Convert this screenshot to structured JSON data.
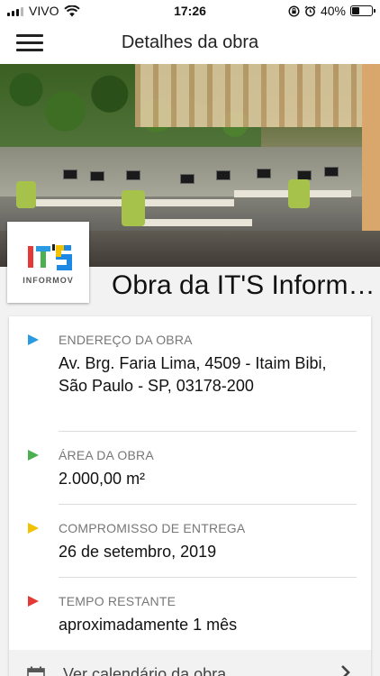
{
  "status_bar": {
    "carrier": "VIVO",
    "time": "17:26",
    "battery": "40%",
    "battery_level": 0.4
  },
  "nav": {
    "title": "Detalhes da obra",
    "menu_icon": "hamburger-menu-icon"
  },
  "project": {
    "title": "Obra da IT'S Inform…",
    "logo_letters": "IT'S",
    "logo_text": "INFORMOV"
  },
  "details": {
    "address": {
      "label": "ENDEREÇO DA OBRA",
      "value": "Av. Brg. Faria Lima, 4509 - Itaim Bibi, São Paulo - SP, 03178-200",
      "color": "#2a9be0"
    },
    "area": {
      "label": "ÁREA DA OBRA",
      "value": "2.000,00 m²",
      "color": "#4caf50"
    },
    "delivery": {
      "label": "COMPROMISSO DE ENTREGA",
      "value": "26 de setembro, 2019",
      "color": "#f2c200"
    },
    "remaining": {
      "label": "TEMPO RESTANTE",
      "value": "aproximadamente 1 mês",
      "color": "#e53935"
    }
  },
  "calendar": {
    "label": "Ver calendário da obra",
    "icon": "calendar-icon"
  }
}
